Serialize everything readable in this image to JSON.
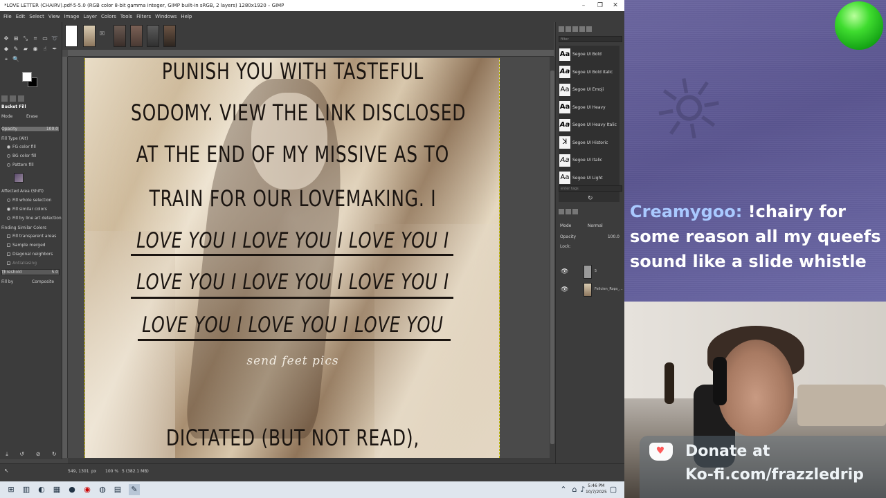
{
  "window": {
    "title": "*LOVE LETTER (CHAIRV).pdf-5-5.0 (RGB color 8-bit gamma integer, GIMP built-in sRGB, 2 layers) 1280x1920 – GIMP",
    "controls": [
      "–",
      "❐",
      "✕"
    ]
  },
  "menu": [
    "File",
    "Edit",
    "Select",
    "View",
    "Image",
    "Layer",
    "Colors",
    "Tools",
    "Filters",
    "Windows",
    "Help"
  ],
  "toolbox": {
    "tool_title": "Bucket Fill",
    "mode_label": "Mode",
    "mode_value": "Erase",
    "opacity_label": "Opacity",
    "opacity_value": "100.0",
    "fill_type_label": "Fill Type  (Alt)",
    "fill_types": [
      "FG color fill",
      "BG color fill",
      "Pattern fill"
    ],
    "affected_label": "Affected Area  (Shift)",
    "affected": [
      "Fill whole selection",
      "Fill similar colors",
      "Fill by line art detection"
    ],
    "similar_label": "Finding Similar Colors",
    "similar_opts": [
      "Fill transparent areas",
      "Sample merged",
      "Diagonal neighbors",
      "Antialiasing"
    ],
    "threshold_label": "Threshold",
    "threshold_value": "5.0",
    "fillby_label": "Fill by",
    "fillby_value": "Composite"
  },
  "canvas": {
    "lines_plain": [
      "PUNISH YOU WITH TASTEFUL",
      "SODOMY. VIEW THE LINK DISCLOSED",
      "AT THE END OF MY MISSIVE AS TO",
      "TRAIN FOR OUR LOVEMAKING. I"
    ],
    "lines_love": [
      "LOVE YOU I LOVE YOU I LOVE YOU I",
      "LOVE YOU I LOVE YOU I LOVE YOU I",
      "LOVE YOU I LOVE YOU I LOVE YOU"
    ],
    "signature": "send feet pics",
    "footer": "DICTATED (BUT NOT READ),"
  },
  "status": {
    "coords": "549, 1301",
    "unit": "px",
    "zoom": "100 %",
    "layer_info": "5 (382.1 MB)"
  },
  "dock": {
    "fonts": [
      "Segoe UI Bold",
      "Segoe UI Bold Italic",
      "Segoe UI Emoji",
      "Segoe UI Heavy",
      "Segoe UI Heavy Italic",
      "Segoe UI Historic",
      "Segoe UI Italic",
      "Segoe UI Light"
    ],
    "filter_placeholder": "filter",
    "tags_placeholder": "enter tags",
    "mode_label": "Mode",
    "mode_value": "Normal",
    "opacity_label": "Opacity",
    "opacity_value": "100.0",
    "lock_label": "Lock:",
    "layers": [
      "5",
      "Felicien_Rops_..."
    ]
  },
  "stream": {
    "chat_user": "Creamygoo:",
    "chat_message": " !chairy for some reason all my queefs sound like a slide whistle",
    "donate_line1": "Donate at",
    "donate_line2": "Ko-fi.com/frazzledrip"
  },
  "taskbar": {
    "time": "5:46 PM",
    "date": "10/7/2025"
  }
}
